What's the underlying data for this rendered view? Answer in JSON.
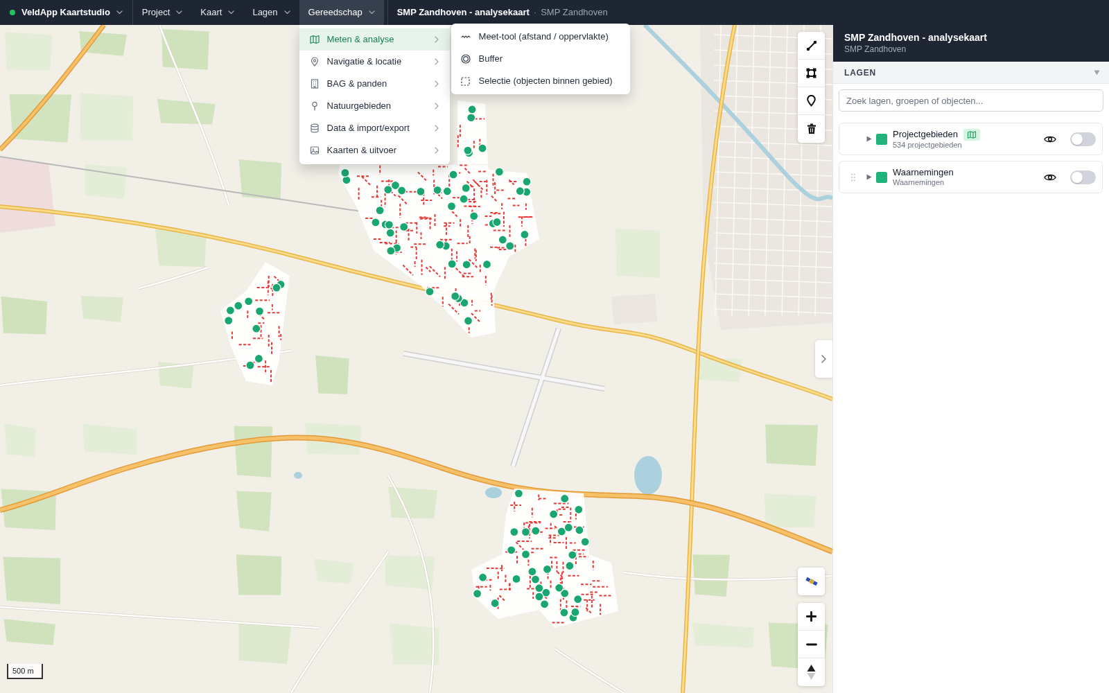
{
  "navbar": {
    "brand": {
      "label": "VeldApp Kaartstudio",
      "online": true
    },
    "menus": [
      {
        "label": "Project",
        "selected": false
      },
      {
        "label": "Kaart",
        "selected": false
      },
      {
        "label": "Lagen",
        "selected": false
      },
      {
        "label": "Gereedschap",
        "selected": true
      }
    ],
    "document": {
      "title": "SMP Zandhoven - analysekaart",
      "separator": "·",
      "subtitle": "SMP Zandhoven"
    }
  },
  "tools_menu": {
    "items": [
      {
        "label": "Meten & analyse",
        "selected": true
      },
      {
        "label": "Navigatie & locatie",
        "selected": false
      },
      {
        "label": "BAG & panden",
        "selected": false
      },
      {
        "label": "Natuurgebieden",
        "selected": false
      },
      {
        "label": "Data & import/export",
        "selected": false
      },
      {
        "label": "Kaarten & uitvoer",
        "selected": false
      }
    ],
    "submenu": {
      "items": [
        {
          "label": "Meet-tool (afstand / oppervlakte)"
        },
        {
          "label": "Buffer"
        },
        {
          "label": "Selectie (objecten binnen gebied)"
        }
      ]
    }
  },
  "map": {
    "scale": "500 m"
  },
  "panel": {
    "title": "SMP Zandhoven - analysekaart",
    "subtitle": "SMP Zandhoven",
    "section": {
      "label": "LAGEN",
      "expanded": true
    },
    "search": {
      "placeholder": "Zoek lagen, groepen of objecten..."
    },
    "layers": [
      {
        "name": "Projectgebieden",
        "description": "534 projectgebieden",
        "color": "#20b37a",
        "badge": true,
        "drag_handle": false,
        "expanded": false,
        "on": false
      },
      {
        "name": "Waarnemingen",
        "description": "Waarnemingen",
        "color": "#20b37a",
        "badge": false,
        "drag_handle": true,
        "expanded": false,
        "on": false
      }
    ]
  }
}
